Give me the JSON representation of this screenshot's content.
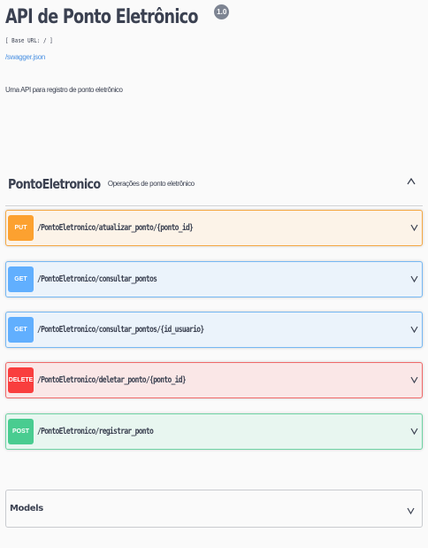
{
  "info": {
    "title": "API de Ponto Eletrônico",
    "version": "1.0",
    "base_url": "[ Base URL: / ]",
    "swagger_link": "/swagger.json",
    "description": "Uma API para registro de ponto eletrônico"
  },
  "tag": {
    "name": "PontoEletronico",
    "description": "Operações de ponto eletrônico",
    "toggle_icon": "chevron-up-icon"
  },
  "operations": [
    {
      "method": "PUT",
      "path": "/PontoEletronico/atualizar_ponto/{ponto_id}",
      "color": "#fca130",
      "bg": "#fcf3e8",
      "border": "#f4a844"
    },
    {
      "method": "GET",
      "path": "/PontoEletronico/consultar_pontos",
      "color": "#61affe",
      "bg": "#ebf3fb",
      "border": "#76b8f3"
    },
    {
      "method": "GET",
      "path": "/PontoEletronico/consultar_pontos/{id_usuario}",
      "color": "#61affe",
      "bg": "#ebf3fb",
      "border": "#76b8f3"
    },
    {
      "method": "DELETE",
      "path": "/PontoEletronico/deletar_ponto/{ponto_id}",
      "color": "#f93e3e",
      "bg": "#fae7e7",
      "border": "#f06969"
    },
    {
      "method": "POST",
      "path": "/PontoEletronico/registrar_ponto",
      "color": "#49cc90",
      "bg": "#e8f6f0",
      "border": "#6fd3a4"
    }
  ],
  "models": {
    "label": "Models",
    "toggle_icon": "chevron-down-icon"
  }
}
